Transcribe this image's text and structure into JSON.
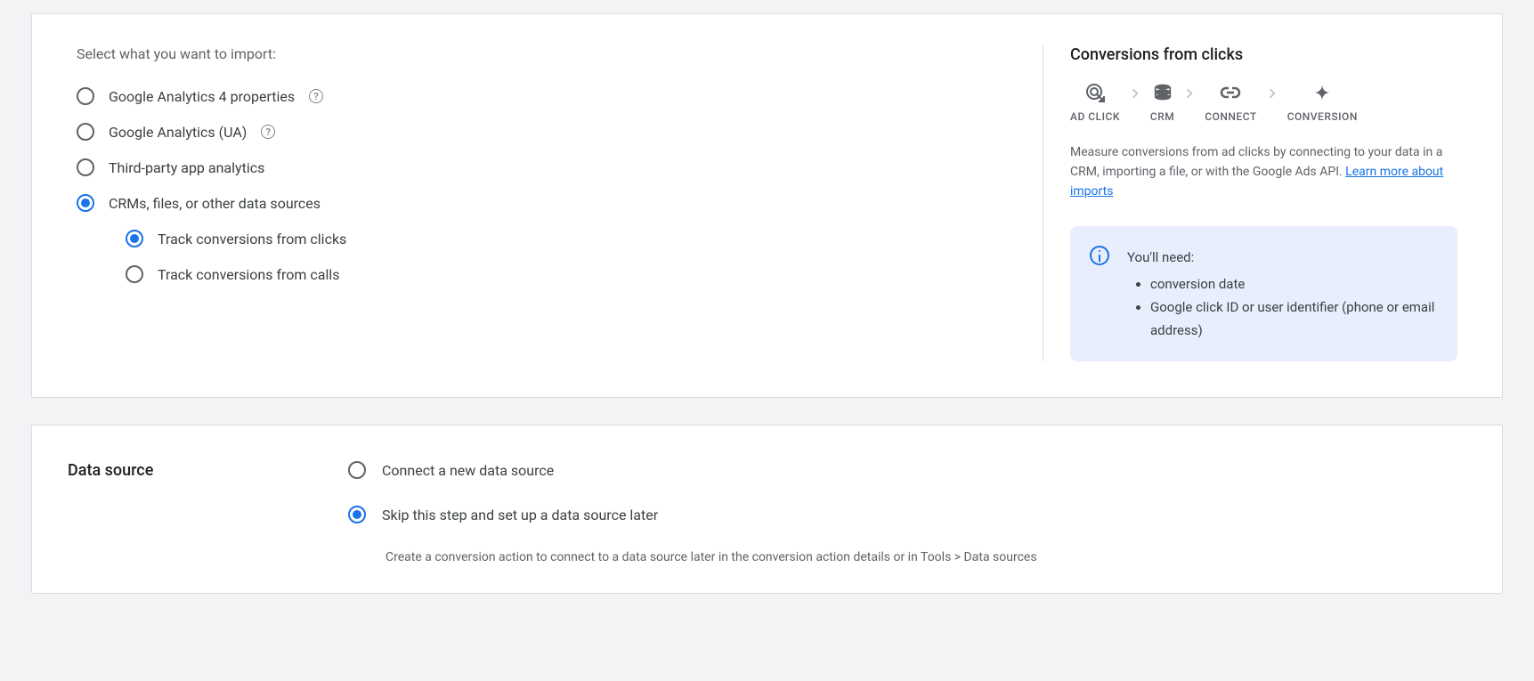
{
  "importPanel": {
    "prompt": "Select what you want to import:",
    "options": [
      {
        "label": "Google Analytics 4 properties",
        "hasHelp": true
      },
      {
        "label": "Google Analytics (UA)",
        "hasHelp": true
      },
      {
        "label": "Third-party app analytics",
        "hasHelp": false
      },
      {
        "label": "CRMs, files, or other data sources",
        "hasHelp": false
      }
    ],
    "subOptions": [
      {
        "label": "Track conversions from clicks"
      },
      {
        "label": "Track conversions from calls"
      }
    ]
  },
  "rightPanel": {
    "title": "Conversions from clicks",
    "flow": [
      {
        "label": "AD CLICK"
      },
      {
        "label": "CRM"
      },
      {
        "label": "CONNECT"
      },
      {
        "label": "CONVERSION"
      }
    ],
    "descriptionPrefix": "Measure conversions from ad clicks by connecting to your data in a CRM, importing a file, or with the Google Ads API. ",
    "linkText": "Learn more about imports",
    "infoBox": {
      "heading": "You'll need:",
      "items": [
        "conversion date",
        "Google click ID or user identifier (phone or email address)"
      ]
    }
  },
  "dataSource": {
    "title": "Data source",
    "options": [
      {
        "label": "Connect a new data source"
      },
      {
        "label": "Skip this step and set up a data source later"
      }
    ],
    "hint": "Create a conversion action to connect to a data source later in the conversion action details or in Tools > Data sources"
  }
}
